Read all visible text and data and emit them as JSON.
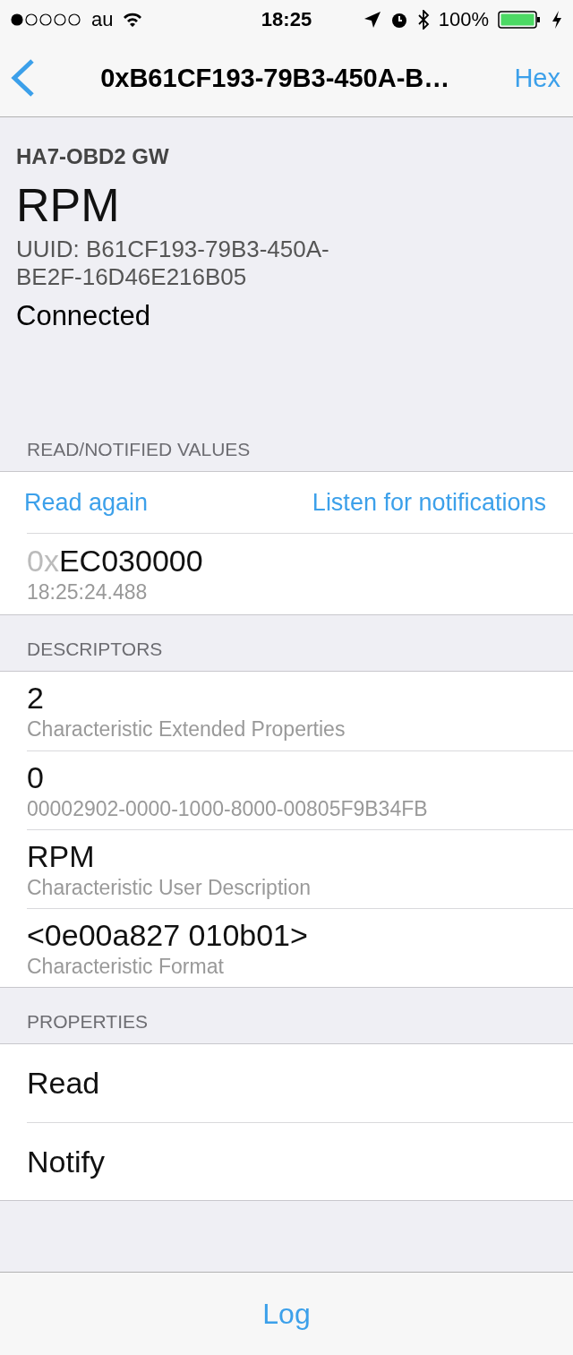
{
  "status_bar": {
    "carrier": "au",
    "time": "18:25",
    "battery": "100%"
  },
  "nav": {
    "title": "0xB61CF193-79B3-450A-B…",
    "action": "Hex"
  },
  "header": {
    "device": "HA7-OBD2 GW",
    "name": "RPM",
    "uuid": "UUID: B61CF193-79B3-450A-BE2F-16D46E216B05",
    "status": "Connected"
  },
  "values": {
    "title": "READ/NOTIFIED VALUES",
    "read_button": "Read again",
    "listen_button": "Listen for notifications",
    "value_prefix": "0x",
    "value": "EC030000",
    "timestamp": "18:25:24.488"
  },
  "descriptors": {
    "title": "DESCRIPTORS",
    "items": [
      {
        "value": "2",
        "label": "Characteristic Extended Properties"
      },
      {
        "value": "0",
        "label": "00002902-0000-1000-8000-00805F9B34FB"
      },
      {
        "value": "RPM",
        "label": "Characteristic User Description"
      },
      {
        "value": "<0e00a827 010b01>",
        "label": "Characteristic Format"
      }
    ]
  },
  "properties": {
    "title": "PROPERTIES",
    "items": [
      "Read",
      "Notify"
    ]
  },
  "tab_bar": {
    "label": "Log"
  }
}
